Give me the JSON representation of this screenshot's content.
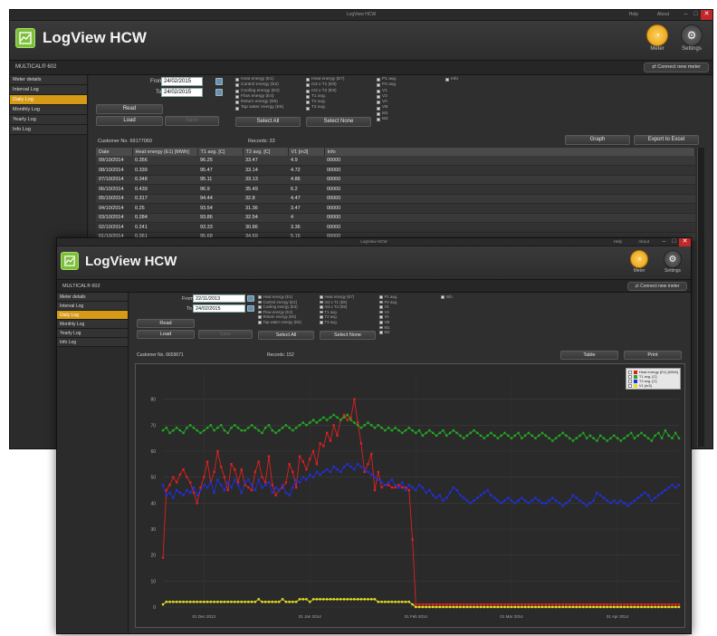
{
  "app": {
    "window_title": "LogView HCW",
    "name": "LogView HCW",
    "help": "Help",
    "about": "About",
    "meter_label": "Meter",
    "settings_label": "Settings",
    "device": "MULTICAL® 602",
    "connect_label": "Connect new meter"
  },
  "sidebar": {
    "items": [
      {
        "label": "Meter details"
      },
      {
        "label": "Interval Log"
      },
      {
        "label": "Daily Log",
        "active": true
      },
      {
        "label": "Monthly Log"
      },
      {
        "label": "Yearly Log"
      },
      {
        "label": "Info Log"
      }
    ]
  },
  "form1": {
    "from_label": "From",
    "from_value": "24/02/2015",
    "to_label": "To",
    "to_value": "24/02/2015",
    "read_label": "Read",
    "load_label": "Load",
    "save_label": "Save",
    "select_all": "Select All",
    "select_none": "Select None"
  },
  "form2": {
    "from_label": "From",
    "from_value": "22/11/2013",
    "to_label": "To",
    "to_value": "24/02/2015",
    "read_label": "Read",
    "load_label": "Load",
    "save_label": "Save",
    "select_all": "Select All",
    "select_none": "Select None"
  },
  "checks": {
    "col1": [
      "Heat energy (E1)",
      "Control energy (E2)",
      "Cooling energy (E3)",
      "Flow energy (E4)",
      "Return energy (E5)",
      "Tap water energy (E6)"
    ],
    "col2": [
      "Heat energy (E7)",
      "m3 x T1 (E8)",
      "m3 x T2 (E9)",
      "T1 avg.",
      "T2 avg.",
      "T3 avg."
    ],
    "col3": [
      "P1 avg.",
      "P2 avg.",
      "V1",
      "V2",
      "VA",
      "VB",
      "M1",
      "M2"
    ],
    "col4": [
      "Info"
    ]
  },
  "meta1": {
    "customer": "Customer No. 69177060",
    "records": "Records: 33"
  },
  "meta2": {
    "customer": "Customer No. 6659671",
    "records": "Records: 152"
  },
  "buttons1": {
    "graph": "Graph",
    "export": "Export to Excel"
  },
  "buttons2": {
    "table": "Table",
    "print": "Print"
  },
  "table": {
    "headers": [
      "Date",
      "Heat energy (E1) [MWh]",
      "T1 avg. [C]",
      "T2 avg. [C]",
      "V1 [m3]",
      "Info"
    ],
    "rows": [
      [
        "09/10/2014",
        "0.356",
        "96.25",
        "33.47",
        "4.9",
        "00000"
      ],
      [
        "08/10/2014",
        "0.339",
        "95.47",
        "33.14",
        "4.72",
        "00000"
      ],
      [
        "07/10/2014",
        "0.348",
        "95.11",
        "33.13",
        "4.86",
        "00000"
      ],
      [
        "06/10/2014",
        "0.439",
        "96.9",
        "35.49",
        "6.2",
        "00000"
      ],
      [
        "05/10/2014",
        "0.317",
        "94.44",
        "32.8",
        "4.47",
        "00000"
      ],
      [
        "04/10/2014",
        "0.25",
        "93.54",
        "31.36",
        "3.47",
        "00000"
      ],
      [
        "03/10/2014",
        "0.284",
        "93.86",
        "32.54",
        "4",
        "00000"
      ],
      [
        "02/10/2014",
        "0.241",
        "93.33",
        "30.86",
        "3.36",
        "00000"
      ],
      [
        "01/10/2014",
        "0.361",
        "95.68",
        "34.69",
        "5.15",
        "00000"
      ]
    ]
  },
  "chart_data": {
    "type": "line",
    "title": "",
    "x_ticks": [
      "01 Dec 2013",
      "01 Jan 2014",
      "01 Feb 2014",
      "01 Mar 2014",
      "01 Apr 2014"
    ],
    "ylim": [
      0,
      90
    ],
    "y_ticks": [
      0,
      10,
      20,
      30,
      40,
      50,
      60,
      70,
      80
    ],
    "grid": true,
    "legend_position": "top-right",
    "series": [
      {
        "name": "Heat energy (E1) [MWh]",
        "color": "#e02020",
        "values": [
          19,
          45,
          47,
          50,
          48,
          51,
          53,
          50,
          48,
          44,
          40,
          46,
          50,
          56,
          48,
          52,
          60,
          54,
          50,
          45,
          55,
          53,
          48,
          53,
          47,
          46,
          45,
          52,
          56,
          50,
          48,
          58,
          47,
          43,
          45,
          46,
          48,
          55,
          52,
          46,
          58,
          56,
          53,
          57,
          60,
          55,
          63,
          62,
          67,
          64,
          70,
          66,
          72,
          74,
          72,
          73,
          80,
          71,
          63,
          52,
          55,
          59,
          45,
          52,
          46,
          47,
          47,
          46,
          46,
          47,
          46,
          46,
          45,
          26,
          1,
          1,
          1,
          1,
          1,
          1,
          1,
          1,
          1,
          1,
          1,
          1,
          1,
          1,
          1,
          1,
          1,
          1,
          1,
          1,
          1,
          1,
          1,
          1,
          1,
          1,
          1,
          1,
          1,
          1,
          1,
          1,
          1,
          1,
          1,
          1,
          1,
          1,
          1,
          1,
          1,
          1,
          1,
          1,
          1,
          1,
          1,
          1,
          1,
          1,
          1,
          1,
          1,
          1,
          1,
          1,
          1,
          1,
          1,
          1,
          1,
          1,
          1,
          1,
          1,
          1,
          1,
          1,
          1,
          1,
          1,
          1,
          1,
          1,
          1,
          1,
          1,
          1
        ]
      },
      {
        "name": "T1 avg. [C]",
        "color": "#22aa22",
        "values": [
          68,
          69,
          67,
          68,
          69,
          68,
          67,
          69,
          70,
          69,
          68,
          67,
          68,
          69,
          70,
          68,
          69,
          70,
          68,
          67,
          69,
          70,
          69,
          68,
          68,
          69,
          70,
          69,
          68,
          67,
          69,
          70,
          68,
          67,
          68,
          69,
          70,
          69,
          68,
          69,
          70,
          71,
          70,
          71,
          72,
          71,
          72,
          73,
          72,
          73,
          74,
          73,
          72,
          73,
          74,
          72,
          71,
          70,
          69,
          70,
          71,
          70,
          69,
          70,
          69,
          68,
          69,
          68,
          69,
          68,
          67,
          68,
          69,
          68,
          67,
          68,
          66,
          67,
          68,
          67,
          66,
          67,
          68,
          66,
          67,
          68,
          67,
          66,
          65,
          66,
          67,
          68,
          67,
          66,
          65,
          66,
          67,
          66,
          65,
          66,
          67,
          66,
          65,
          66,
          67,
          65,
          66,
          67,
          66,
          65,
          66,
          67,
          66,
          65,
          64,
          65,
          66,
          67,
          66,
          65,
          64,
          65,
          66,
          67,
          65,
          66,
          65,
          64,
          66,
          65,
          64,
          65,
          66,
          65,
          64,
          65,
          66,
          67,
          65,
          66,
          67,
          66,
          65,
          64,
          66,
          67,
          65,
          68,
          66,
          65,
          67,
          65
        ]
      },
      {
        "name": "T2 avg. [C]",
        "color": "#2030e0",
        "values": [
          47,
          43,
          44,
          42,
          45,
          44,
          43,
          45,
          44,
          46,
          43,
          45,
          47,
          46,
          48,
          44,
          49,
          47,
          45,
          48,
          46,
          49,
          47,
          44,
          48,
          49,
          47,
          45,
          49,
          46,
          47,
          48,
          44,
          46,
          45,
          47,
          44,
          43,
          46,
          49,
          48,
          50,
          49,
          51,
          50,
          52,
          51,
          52,
          53,
          52,
          54,
          53,
          52,
          54,
          55,
          54,
          53,
          55,
          54,
          53,
          52,
          51,
          50,
          49,
          48,
          47,
          48,
          49,
          47,
          46,
          48,
          45,
          47,
          46,
          45,
          47,
          46,
          44,
          45,
          43,
          42,
          43,
          41,
          42,
          44,
          46,
          45,
          43,
          42,
          41,
          40,
          41,
          42,
          43,
          44,
          45,
          43,
          42,
          41,
          40,
          41,
          42,
          41,
          40,
          41,
          42,
          41,
          40,
          41,
          42,
          41,
          40,
          40,
          41,
          42,
          41,
          40,
          39,
          40,
          41,
          43,
          42,
          41,
          40,
          39,
          40,
          41,
          44,
          43,
          42,
          41,
          40,
          41,
          40,
          41,
          40,
          39,
          40,
          41,
          42,
          43,
          44,
          43,
          41,
          42,
          43,
          44,
          45,
          46,
          47,
          46,
          47
        ]
      },
      {
        "name": "V1 [m3]",
        "color": "#e8e020",
        "values": [
          1,
          2,
          2,
          2,
          2,
          2,
          2,
          2,
          2,
          2,
          2,
          2,
          2,
          2,
          2,
          2,
          2,
          2,
          2,
          2,
          2,
          2,
          2,
          2,
          2,
          2,
          2,
          2,
          3,
          2,
          2,
          2,
          2,
          2,
          2,
          3,
          2,
          2,
          2,
          2,
          3,
          3,
          3,
          2,
          3,
          3,
          3,
          3,
          3,
          3,
          3,
          3,
          3,
          3,
          3,
          3,
          3,
          3,
          3,
          3,
          3,
          3,
          3,
          2,
          2,
          2,
          2,
          2,
          2,
          2,
          2,
          2,
          2,
          1,
          0,
          0,
          0,
          0,
          0,
          0,
          0,
          0,
          0,
          0,
          0,
          0,
          0,
          0,
          0,
          0,
          0,
          0,
          0,
          0,
          0,
          0,
          0,
          0,
          0,
          0,
          0,
          0,
          0,
          0,
          0,
          0,
          0,
          0,
          0,
          0,
          0,
          0,
          0,
          0,
          0,
          0,
          0,
          0,
          0,
          0,
          0,
          0,
          0,
          0,
          0,
          0,
          0,
          0,
          0,
          0,
          0,
          0,
          0,
          0,
          0,
          0,
          0,
          0,
          0,
          0,
          0,
          0,
          0,
          0,
          0,
          0,
          0,
          0,
          0,
          0,
          0,
          0
        ]
      }
    ]
  }
}
